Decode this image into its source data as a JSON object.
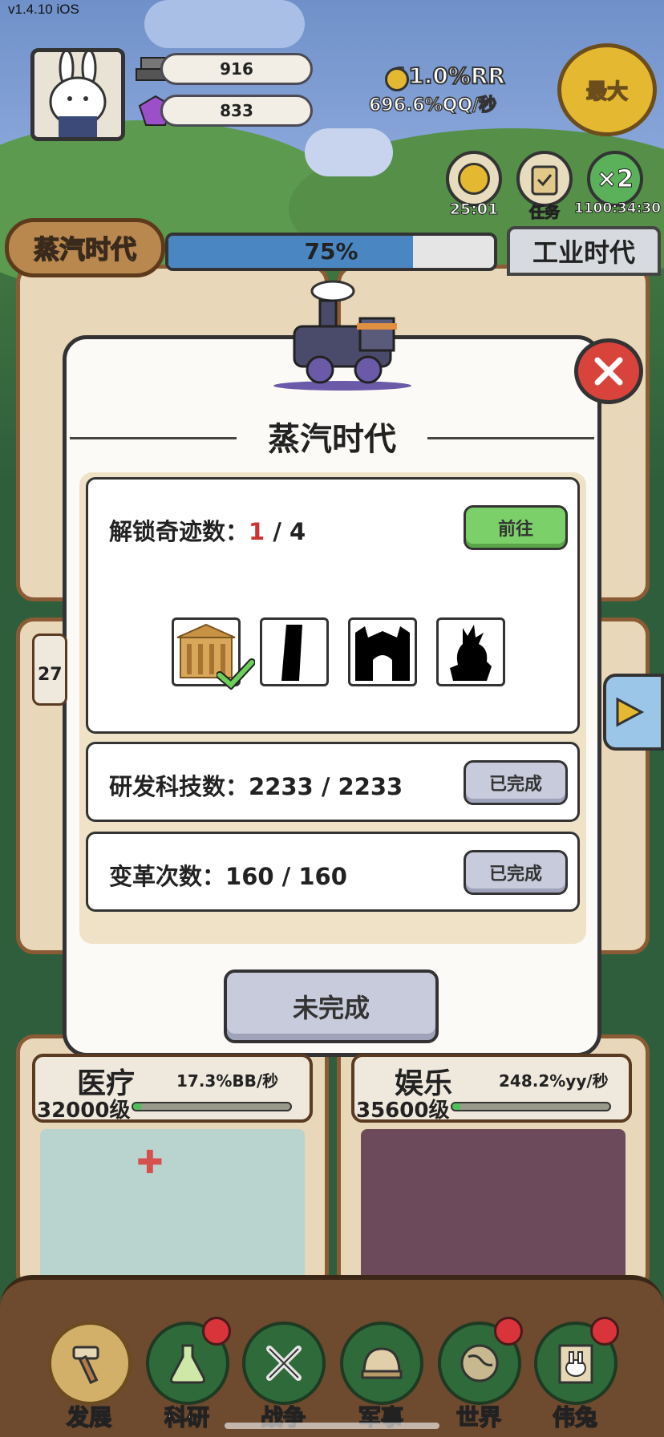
{
  "status_bar": {
    "version": "v1.4.10 iOS"
  },
  "resources": [
    {
      "icon": "steel-ingot-icon",
      "value": "916"
    },
    {
      "icon": "purple-gem-icon",
      "value": "833"
    }
  ],
  "rates": {
    "main": "11.0%RR",
    "sub": "696.6%QQ/秒"
  },
  "max_button": "最大",
  "quick_buttons": [
    {
      "icon": "coin-icon",
      "label": "25:01"
    },
    {
      "icon": "clipboard-icon",
      "label": "任务"
    },
    {
      "icon": "double-boost-icon",
      "text": "×2",
      "label": "1100:34:30"
    }
  ],
  "era": {
    "current": "蒸汽时代",
    "progress_text": "75%",
    "progress": 0.75,
    "next": "工业时代"
  },
  "modal": {
    "title": "蒸汽时代",
    "wonders": {
      "label": "解锁奇迹数：",
      "current": "1",
      "total": "/ 4",
      "button": "前往",
      "items": [
        {
          "name": "wonder-temple",
          "unlocked": true
        },
        {
          "name": "wonder-tower",
          "unlocked": false
        },
        {
          "name": "wonder-gate",
          "unlocked": false
        },
        {
          "name": "wonder-statue",
          "unlocked": false
        }
      ]
    },
    "tech": {
      "label": "研发科技数：",
      "value": "2233 / 2233",
      "button": "已完成"
    },
    "reform": {
      "label": "变革次数：",
      "value": "160 / 160",
      "button": "已完成"
    },
    "main_button": "未完成"
  },
  "cards": [
    {
      "title": "医疗",
      "rate": "17.3%BB/秒",
      "level": "32000级",
      "progress": 0.05
    },
    {
      "title": "娱乐",
      "rate": "248.2%yy/秒",
      "level": "35600级",
      "progress": 0.05
    }
  ],
  "side_label": "27",
  "nav": [
    {
      "label": "发展",
      "icon": "hammer-icon",
      "active": true,
      "dot": false
    },
    {
      "label": "科研",
      "icon": "flask-icon",
      "active": false,
      "dot": true
    },
    {
      "label": "战争",
      "icon": "crossed-swords-icon",
      "active": false,
      "dot": false
    },
    {
      "label": "军事",
      "icon": "helmet-icon",
      "active": false,
      "dot": false
    },
    {
      "label": "世界",
      "icon": "globe-icon",
      "active": false,
      "dot": true
    },
    {
      "label": "伟兔",
      "icon": "portrait-icon",
      "active": false,
      "dot": true
    }
  ],
  "colors": {
    "accent_gold": "#e5b832",
    "progress_blue": "#4a86c2",
    "close_red": "#d8433c",
    "go_green": "#7cd06a"
  }
}
